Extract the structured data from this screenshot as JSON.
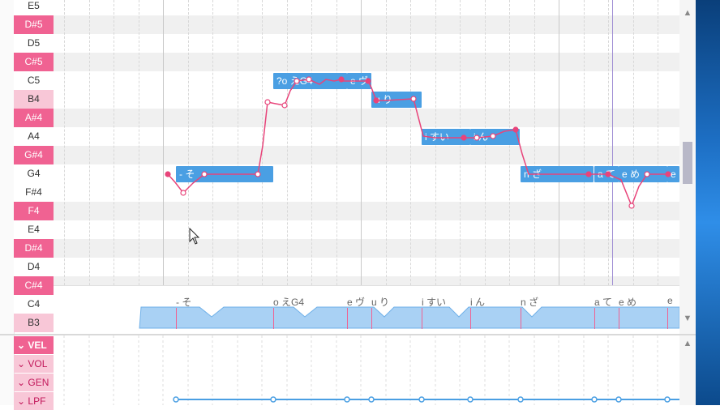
{
  "colors": {
    "accent": "#f06292",
    "note": "#4a9fe3",
    "pitch": "#e8447a",
    "playhead": "#a08fd4"
  },
  "piano_keys": [
    {
      "label": "E5",
      "kind": "white"
    },
    {
      "label": "D#5",
      "kind": "black"
    },
    {
      "label": "D5",
      "kind": "white"
    },
    {
      "label": "C#5",
      "kind": "black"
    },
    {
      "label": "C5",
      "kind": "white"
    },
    {
      "label": "B4",
      "kind": "hl"
    },
    {
      "label": "A#4",
      "kind": "black"
    },
    {
      "label": "A4",
      "kind": "white"
    },
    {
      "label": "G#4",
      "kind": "black"
    },
    {
      "label": "G4",
      "kind": "white"
    },
    {
      "label": "F#4",
      "kind": "white"
    },
    {
      "label": "F4",
      "kind": "black"
    },
    {
      "label": "E4",
      "kind": "white"
    },
    {
      "label": "D#4",
      "kind": "black"
    },
    {
      "label": "D4",
      "kind": "white"
    },
    {
      "label": "C#4",
      "kind": "black"
    },
    {
      "label": "C4",
      "kind": "white"
    },
    {
      "label": "B3",
      "kind": "hl"
    }
  ],
  "notes": [
    {
      "lyric": "- そ",
      "pitch": "G4"
    },
    {
      "lyric": "?o えG4",
      "pitch": "C5"
    },
    {
      "lyric": "e ヴ",
      "pitch": "C5"
    },
    {
      "lyric": "u り",
      "pitch": "B4"
    },
    {
      "lyric": "i すい",
      "pitch": "A4"
    },
    {
      "lyric": "i ん",
      "pitch": "A4"
    },
    {
      "lyric": "n ざ",
      "pitch": "G4"
    },
    {
      "lyric": "a て",
      "pitch": "G4"
    },
    {
      "lyric": "e め",
      "pitch": "G4"
    },
    {
      "lyric": "e",
      "pitch": "G4"
    }
  ],
  "phonemes": [
    "- そ",
    "o えG4",
    "e ヴ",
    "u り",
    "i すい",
    "i ん",
    "n ざ",
    "a て",
    "e め",
    "e"
  ],
  "expressions": [
    {
      "label": "VEL",
      "icon": "chevron-down-icon",
      "style": "dark"
    },
    {
      "label": "VOL",
      "icon": "chevron-down-icon",
      "style": "light"
    },
    {
      "label": "GEN",
      "icon": "chevron-down-icon",
      "style": "light"
    },
    {
      "label": "LPF",
      "icon": "chevron-down-icon",
      "style": "light"
    }
  ],
  "scroll": {
    "up_icon": "triangle-up-icon",
    "down_icon": "triangle-down-icon"
  }
}
